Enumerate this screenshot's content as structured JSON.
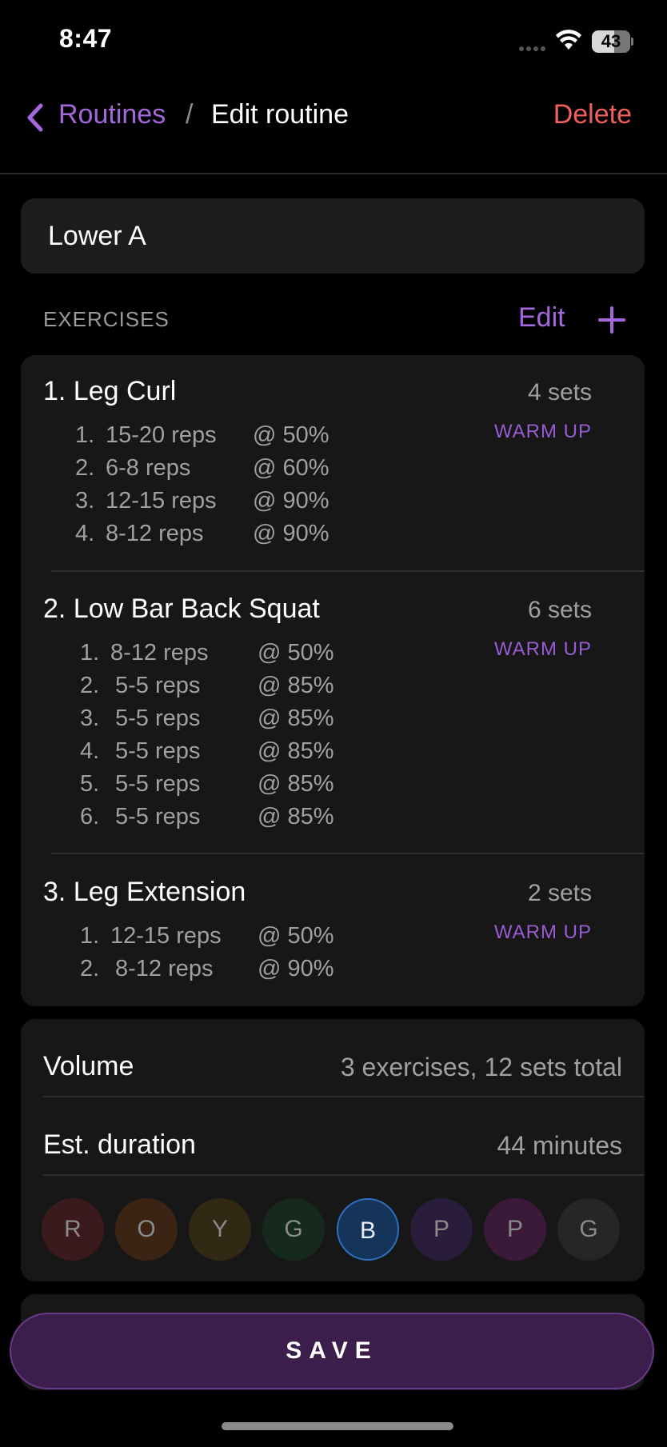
{
  "status_bar": {
    "time": "8:47",
    "battery": "43"
  },
  "nav": {
    "back_label": "Routines",
    "separator": "/",
    "title": "Edit routine",
    "delete_label": "Delete"
  },
  "routine": {
    "name": "Lower A"
  },
  "exercises_section": {
    "label": "EXERCISES",
    "edit_label": "Edit"
  },
  "exercises": [
    {
      "title": "1.  Leg Curl",
      "sets_label": "4 sets",
      "tag": "WARM UP",
      "sets": [
        {
          "num": "1.",
          "reps": "15-20 reps",
          "pct": "@ 50%"
        },
        {
          "num": "2.",
          "reps": "6-8 reps",
          "pct": "@ 60%"
        },
        {
          "num": "3.",
          "reps": "12-15 reps",
          "pct": "@ 90%"
        },
        {
          "num": "4.",
          "reps": "8-12 reps",
          "pct": "@ 90%"
        }
      ]
    },
    {
      "title": "2.  Low Bar Back Squat",
      "sets_label": "6 sets",
      "tag": "WARM UP",
      "sets": [
        {
          "num": "1.",
          "reps": "8-12 reps",
          "pct": "@ 50%"
        },
        {
          "num": "2.",
          "reps": "5-5 reps",
          "pct": "@ 85%"
        },
        {
          "num": "3.",
          "reps": "5-5 reps",
          "pct": "@ 85%"
        },
        {
          "num": "4.",
          "reps": "5-5 reps",
          "pct": "@ 85%"
        },
        {
          "num": "5.",
          "reps": "5-5 reps",
          "pct": "@ 85%"
        },
        {
          "num": "6.",
          "reps": "5-5 reps",
          "pct": "@ 85%"
        }
      ]
    },
    {
      "title": "3.  Leg Extension",
      "sets_label": "2 sets",
      "tag": "WARM UP",
      "sets": [
        {
          "num": "1.",
          "reps": "12-15 reps",
          "pct": "@ 50%"
        },
        {
          "num": "2.",
          "reps": "8-12 reps",
          "pct": "@ 90%"
        }
      ]
    }
  ],
  "summary": {
    "volume_label": "Volume",
    "volume_value": "3 exercises, 12 sets total",
    "duration_label": "Est. duration",
    "duration_value": "44 minutes"
  },
  "colors": [
    {
      "letter": "R",
      "bg": "#3a1a1d",
      "selected": false
    },
    {
      "letter": "O",
      "bg": "#3b2414",
      "selected": false
    },
    {
      "letter": "Y",
      "bg": "#322914",
      "selected": false
    },
    {
      "letter": "G",
      "bg": "#16291d",
      "selected": false
    },
    {
      "letter": "B",
      "bg": "#153459",
      "selected": true
    },
    {
      "letter": "P",
      "bg": "#2a1d3b",
      "selected": false
    },
    {
      "letter": "P",
      "bg": "#3a1a38",
      "selected": false
    },
    {
      "letter": "G",
      "bg": "#262626",
      "selected": false
    }
  ],
  "save": {
    "label": "SAVE"
  },
  "theme": {
    "accent": "#a468dc",
    "danger": "#f0605c",
    "save_bg": "#3b1e4c"
  }
}
